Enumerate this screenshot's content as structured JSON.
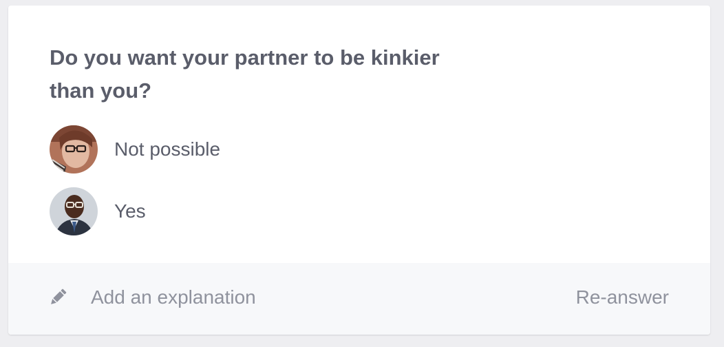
{
  "question": {
    "text": "Do you want your partner to be kinkier than you?"
  },
  "answers": [
    {
      "text": "Not possible",
      "avatar": "user-avatar-woman-glasses"
    },
    {
      "text": "Yes",
      "avatar": "user-avatar-man-glasses"
    }
  ],
  "footer": {
    "explain_icon": "pencil-icon",
    "explain_label": "Add an explanation",
    "reanswer_label": "Re-answer"
  },
  "colors": {
    "text_primary": "#5a5d6a",
    "text_muted": "#8f929d",
    "footer_bg": "#f7f8fa"
  }
}
